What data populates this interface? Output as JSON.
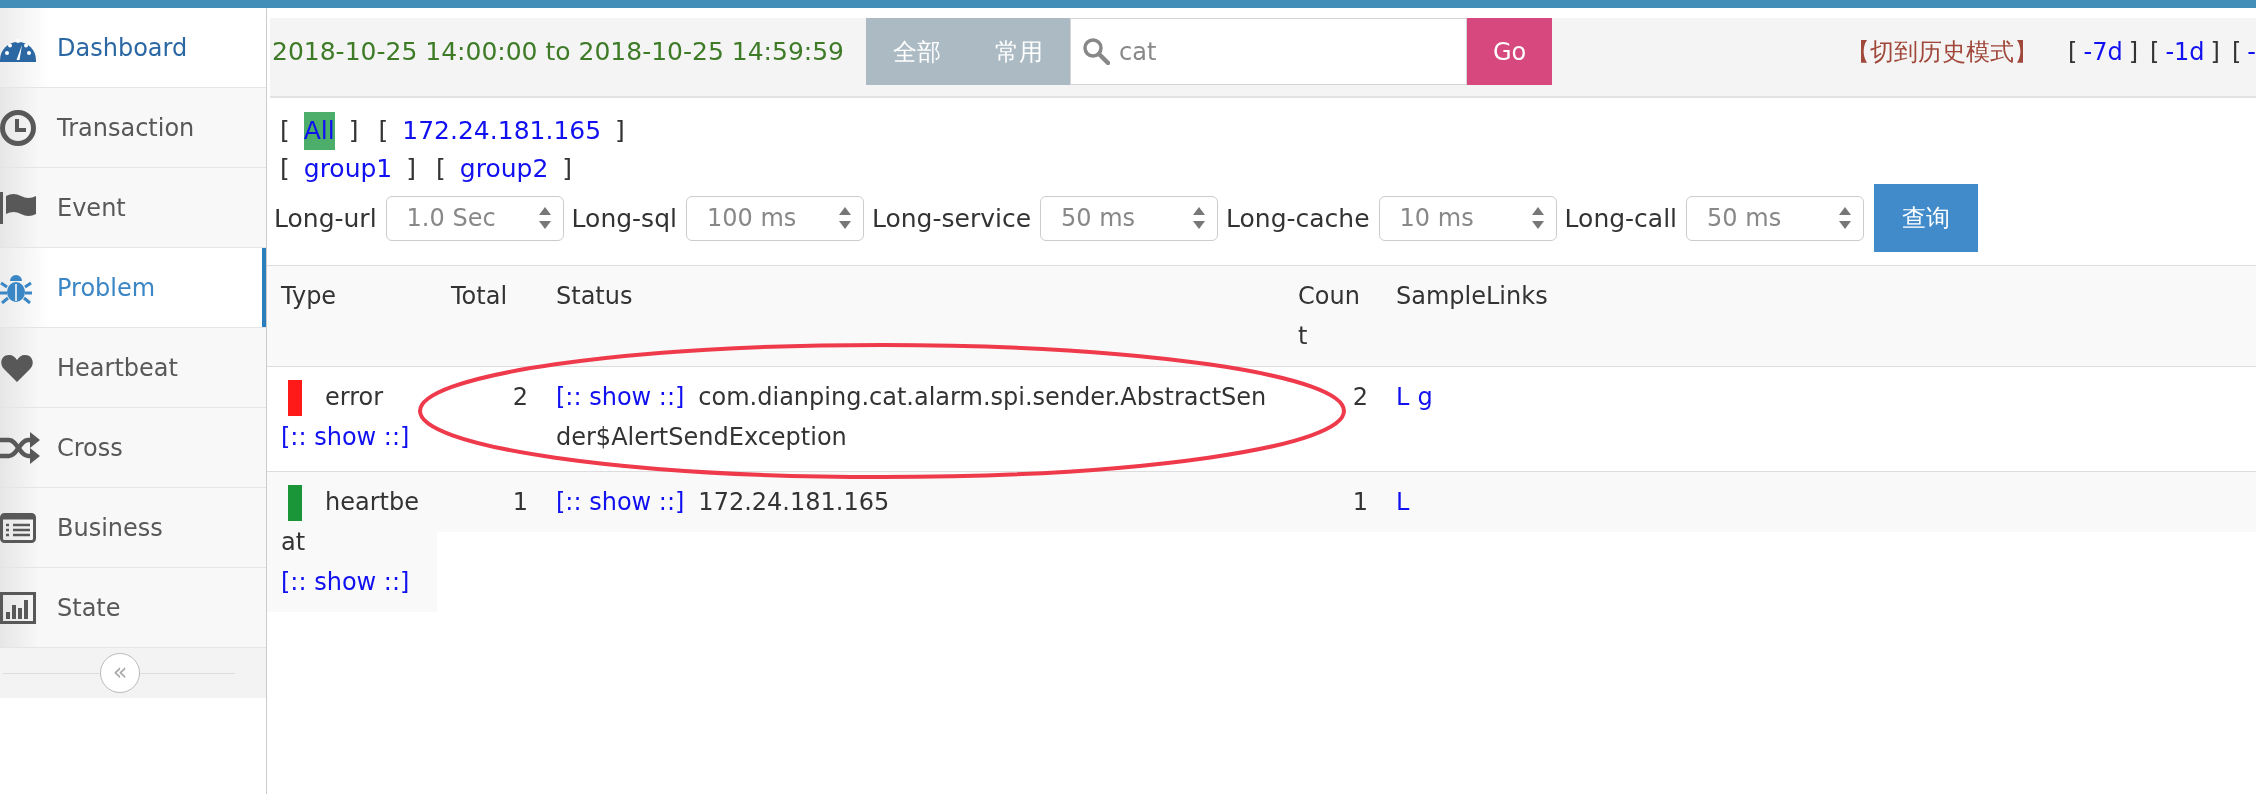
{
  "sidebar": {
    "items": [
      {
        "label": "Dashboard",
        "selected": false,
        "highlighted": true
      },
      {
        "label": "Transaction",
        "selected": false,
        "highlighted": false
      },
      {
        "label": "Event",
        "selected": false,
        "highlighted": false
      },
      {
        "label": "Problem",
        "selected": true,
        "highlighted": false
      },
      {
        "label": "Heartbeat",
        "selected": false,
        "highlighted": false
      },
      {
        "label": "Cross",
        "selected": false,
        "highlighted": false
      },
      {
        "label": "Business",
        "selected": false,
        "highlighted": false
      },
      {
        "label": "State",
        "selected": false,
        "highlighted": false
      }
    ],
    "collapse_button": "«"
  },
  "toolbar": {
    "date_range": "2018-10-25 14:00:00 to 2018-10-25 14:59:59",
    "scope_buttons": [
      "全部",
      "常用"
    ],
    "search": {
      "value": "cat"
    },
    "go_button": "Go",
    "history_mode_link": "【切到历史模式】",
    "range_links": [
      {
        "prefix": "[",
        "label": "-7d",
        "suffix": "]"
      },
      {
        "prefix": "[",
        "label": "-1d",
        "suffix": "]"
      },
      {
        "prefix": "[",
        "label": "-"
      }
    ]
  },
  "hosts": [
    {
      "prefix": "[",
      "label": "All",
      "suffix": "]",
      "selected": true
    },
    {
      "prefix": "[",
      "label": "172.24.181.165",
      "suffix": "]",
      "selected": false
    }
  ],
  "groups": [
    {
      "prefix": "[",
      "label": "group1",
      "suffix": "]"
    },
    {
      "prefix": "[",
      "label": "group2",
      "suffix": "]"
    }
  ],
  "thresholds": [
    {
      "label": "Long-url",
      "value": "1.0 Sec"
    },
    {
      "label": "Long-sql",
      "value": "100 ms"
    },
    {
      "label": "Long-service",
      "value": "50 ms"
    },
    {
      "label": "Long-cache",
      "value": "10 ms"
    },
    {
      "label": "Long-call",
      "value": "50 ms"
    }
  ],
  "query_button": "查询",
  "table": {
    "columns": [
      "Type",
      "Total",
      "Status",
      "Count",
      "SampleLinks"
    ],
    "rows": [
      {
        "type": "error",
        "color": "#ff1a1a",
        "type_link": "[:: show ::]",
        "total": "2",
        "status_link": "[:: show ::]",
        "status": "com.dianping.cat.alarm.spi.sender.AbstractSender$AlertSendException",
        "count": "2",
        "sample_links": [
          "L",
          "g"
        ]
      },
      {
        "type": "heartbeat",
        "color": "#1a9638",
        "type_link": "[:: show ::]",
        "total": "1",
        "status_link": "[:: show ::]",
        "status": "172.24.181.165",
        "count": "1",
        "sample_links": [
          "L"
        ]
      }
    ]
  },
  "annotation": {
    "kind": "ellipse"
  }
}
